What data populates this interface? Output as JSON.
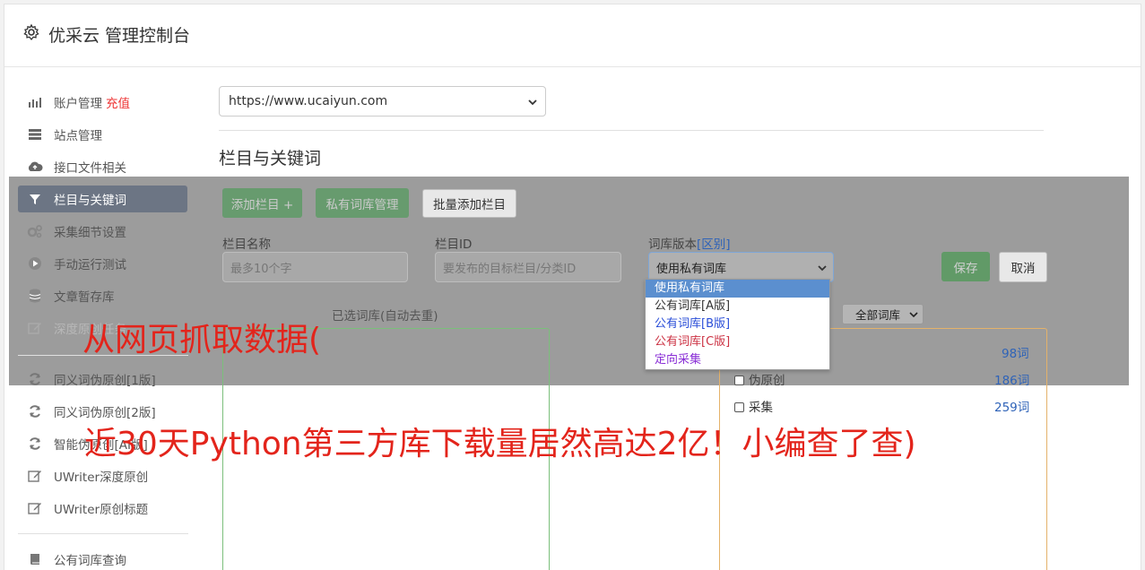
{
  "header": {
    "title": "优采云 管理控制台",
    "icon": "gear-icon"
  },
  "sidebar": {
    "items": [
      {
        "label": "账户管理",
        "badge": "充值",
        "icon": "bar-chart-icon"
      },
      {
        "label": "站点管理",
        "icon": "server-icon"
      },
      {
        "label": "接口文件相关",
        "icon": "cloud-upload-icon"
      },
      {
        "label": "栏目与关键词",
        "icon": "filter-icon",
        "active": true
      },
      {
        "label": "采集细节设置",
        "icon": "cogs-icon"
      },
      {
        "label": "手动运行测试",
        "icon": "play-circle-icon"
      },
      {
        "label": "文章暂存库",
        "icon": "database-icon"
      },
      {
        "label": "深度原创任务",
        "icon": "edit-icon"
      },
      {
        "label": "同义词伪原创[1版]",
        "icon": "refresh-icon"
      },
      {
        "label": "同义词伪原创[2版]",
        "icon": "refresh-icon"
      },
      {
        "label": "智能伪原创[AI版]",
        "icon": "refresh-icon"
      },
      {
        "label": "UWriter深度原创",
        "icon": "edit-icon"
      },
      {
        "label": "UWriter原创标题",
        "icon": "edit-icon"
      },
      {
        "label": "公有词库查询",
        "icon": "book-icon"
      }
    ]
  },
  "main": {
    "site_select": {
      "value": "https://www.ucaiyun.com"
    },
    "section_title": "栏目与关键词",
    "buttons": {
      "add_column": "添加栏目 +",
      "private_lib": "私有词库管理",
      "batch_add": "批量添加栏目",
      "save": "保存",
      "cancel": "取消"
    },
    "fields": {
      "name": {
        "label": "栏目名称",
        "placeholder": "最多10个字"
      },
      "id": {
        "label": "栏目ID",
        "placeholder": "要发布的目标栏目/分类ID"
      },
      "version": {
        "label": "词库版本",
        "label_link": "[区别]",
        "value": "使用私有词库"
      }
    },
    "dropdown_options": [
      "使用私有词库",
      "公有词库[A版]",
      "公有词库[B版]",
      "公有词库[C版]",
      "定向采集"
    ],
    "selected_label": "已选词库(自动去重)",
    "filter_select": "全部词库",
    "library_rows": [
      {
        "label": "",
        "count": "98词"
      },
      {
        "label": "伪原创",
        "count": "186词"
      },
      {
        "label": "采集",
        "count": "259词"
      }
    ]
  },
  "overlay": {
    "line1": "从网页抓取数据(",
    "line2": "近30天Python第三方库下载量居然高达2亿！小编查了查)"
  },
  "colors": {
    "accent": "#3a9a45",
    "active_nav": "#6c7584",
    "overlay_text": "#e3241b",
    "link": "#2f63b8"
  }
}
